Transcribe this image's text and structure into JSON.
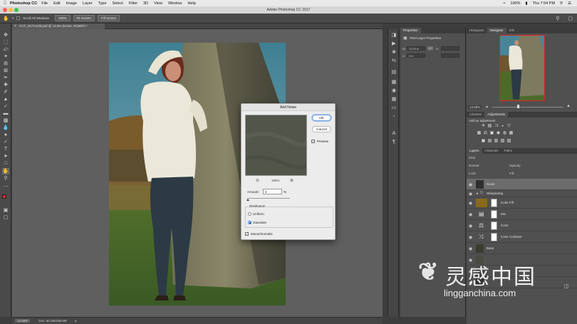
{
  "menubar": {
    "app_name": "Photoshop CC",
    "items": [
      "File",
      "Edit",
      "Image",
      "Layer",
      "Type",
      "Select",
      "Filter",
      "3D",
      "View",
      "Window",
      "Help"
    ],
    "battery": "100%",
    "clock": "Thu 7:54 PM"
  },
  "window": {
    "title": "Adobe Photoshop CC 2017"
  },
  "options": {
    "scroll_all_windows": "Scroll All Windows",
    "zoom_100": "100%",
    "fit_screen": "Fit Screen",
    "fill_screen": "Fill Screen"
  },
  "document": {
    "tab_title": "CCF_0173-Edit.psd @ 13.6% (Noise, RGB/8*) *",
    "status_zoom": "13.68%",
    "status_doc": "Doc: 60.2M/338.8M"
  },
  "dialog": {
    "title": "Add Noise",
    "ok_label": "OK",
    "cancel_label": "Cancel",
    "preview_label": "Preview",
    "preview_checked": true,
    "zoom_level": "100%",
    "amount_label": "Amount:",
    "amount_value": "2",
    "amount_unit": "%",
    "distribution_label": "Distribution",
    "uniform_label": "Uniform",
    "gaussian_label": "Gaussian",
    "distribution_selected": "Gaussian",
    "monochromatic_label": "Monochromatic",
    "monochromatic_checked": true
  },
  "properties": {
    "tab": "Properties",
    "header": "Pixel Layer Properties",
    "w_label": "W:",
    "w_value": "12.02 in",
    "x_label": "X:",
    "x_value": "0 in",
    "h_label": "H:",
    "go_label": "GO"
  },
  "navigator": {
    "tabs": [
      "Histogram",
      "Navigator",
      "Info"
    ],
    "active_tab": "Navigator",
    "zoom": "13.68%"
  },
  "adjustments": {
    "tabs": [
      "Libraries",
      "Adjustments"
    ],
    "active_tab": "Adjustments",
    "add_label": "Add an adjustment"
  },
  "layers": {
    "tabs": [
      "Layers",
      "Channels",
      "Paths"
    ],
    "active_tab": "Layers",
    "kind_label": "Kind",
    "blend_mode": "Normal",
    "opacity_label": "Opacity:",
    "lock_label": "Lock:",
    "fill_label": "Fill:",
    "rows": [
      {
        "name": "Noise",
        "selected": true
      },
      {
        "name": "Sharpening",
        "selected": false
      },
      {
        "name": "Color Fill",
        "selected": false
      },
      {
        "name": "Mix",
        "selected": false
      },
      {
        "name": "Color",
        "selected": false
      },
      {
        "name": "Color Contrast",
        "selected": false
      },
      {
        "name": "Base",
        "selected": false
      }
    ]
  },
  "watermark": {
    "cn_text": "灵感中国",
    "url": "lingganchina.com"
  },
  "colors": {
    "accent": "#1473e6",
    "dialog_bg": "#ececec",
    "panel_bg": "#505050",
    "canvas_bg": "#5f5f5f",
    "foreground_swatch": "#d52a2a",
    "background_swatch": "#ffffff"
  }
}
